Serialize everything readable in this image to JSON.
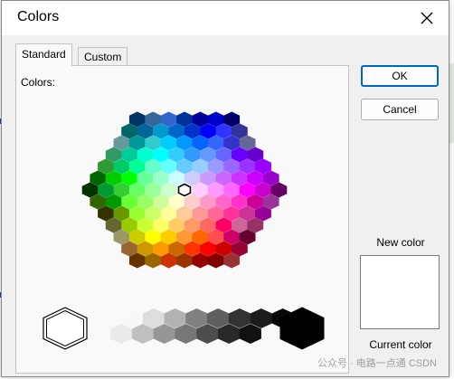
{
  "dialog": {
    "title": "Colors",
    "close_icon": "close-icon",
    "tabs": [
      {
        "label": "Standard",
        "selected": true
      },
      {
        "label": "Custom",
        "selected": false
      }
    ],
    "colors_label": "Colors:",
    "ok_label": "OK",
    "cancel_label": "Cancel",
    "new_color_label": "New color",
    "current_color_label": "Current color",
    "new_color_value": "#FFFFFF"
  },
  "palette": {
    "rows": [
      [
        "#003366",
        "#336699",
        "#3366CC",
        "#003399",
        "#000099",
        "#0000CC",
        "#000066"
      ],
      [
        "#006666",
        "#006699",
        "#0099CC",
        "#0066CC",
        "#0033CC",
        "#0000FF",
        "#3333FF",
        "#333399"
      ],
      [
        "#669999",
        "#009999",
        "#33CCCC",
        "#00CCFF",
        "#0099FF",
        "#0066FF",
        "#3366FF",
        "#3333CC",
        "#666699"
      ],
      [
        "#339966",
        "#00CC99",
        "#00FFCC",
        "#00FFFF",
        "#33CCFF",
        "#3399FF",
        "#6699FF",
        "#6666FF",
        "#6600FF",
        "#6600CC"
      ],
      [
        "#339933",
        "#00CC66",
        "#00FF99",
        "#66FFCC",
        "#66FFFF",
        "#66CCFF",
        "#99CCFF",
        "#9999FF",
        "#9966FF",
        "#9933FF",
        "#9900FF"
      ],
      [
        "#006600",
        "#00CC00",
        "#00FF00",
        "#66FF99",
        "#99FFCC",
        "#CCFFFF",
        "#CCCCFF",
        "#CC99FF",
        "#CC66FF",
        "#CC33FF",
        "#CC00FF",
        "#9900CC"
      ],
      [
        "#003300",
        "#009933",
        "#33CC33",
        "#66FF66",
        "#99FF99",
        "#CCFFCC",
        "#FFFFFF",
        "#FFCCFF",
        "#FF99FF",
        "#FF66FF",
        "#FF00FF",
        "#CC00CC",
        "#660066"
      ],
      [
        "#336600",
        "#009900",
        "#66FF33",
        "#99FF66",
        "#CCFF99",
        "#FFFFCC",
        "#FFCCCC",
        "#FF99CC",
        "#FF66CC",
        "#FF33CC",
        "#CC0099",
        "#993399"
      ],
      [
        "#333300",
        "#669900",
        "#99FF33",
        "#CCFF66",
        "#FFFF99",
        "#FFCC99",
        "#FF9999",
        "#FF6699",
        "#FF3399",
        "#CC3399",
        "#990099"
      ],
      [
        "#666633",
        "#99CC00",
        "#CCFF33",
        "#FFFF66",
        "#FFCC66",
        "#FF9966",
        "#FF6666",
        "#FF0066",
        "#CC6699",
        "#993366"
      ],
      [
        "#999966",
        "#CCCC00",
        "#FFFF00",
        "#FFCC00",
        "#FF9933",
        "#FF6600",
        "#FF5050",
        "#CC0066",
        "#660033"
      ],
      [
        "#996633",
        "#CC9900",
        "#FF9900",
        "#CC6600",
        "#FF3300",
        "#FF0000",
        "#CC0000",
        "#990033"
      ],
      [
        "#663300",
        "#996600",
        "#CC3300",
        "#993300",
        "#990000",
        "#800000",
        "#993333"
      ]
    ],
    "selected": "#FFFFFF",
    "gray_row_top": [
      "#F8F8F8",
      "#DDDDDD",
      "#B2B2B2",
      "#808080",
      "#5F5F5F",
      "#333333",
      "#1C1C1C",
      "#080808"
    ],
    "gray_row_bottom": [
      "#EAEAEA",
      "#C0C0C0",
      "#969696",
      "#777777",
      "#4D4D4D",
      "#292929",
      "#111111"
    ],
    "white_large": "#FFFFFF",
    "black_large": "#000000"
  },
  "watermark": "公众号 · 电路一点通  CSDN"
}
